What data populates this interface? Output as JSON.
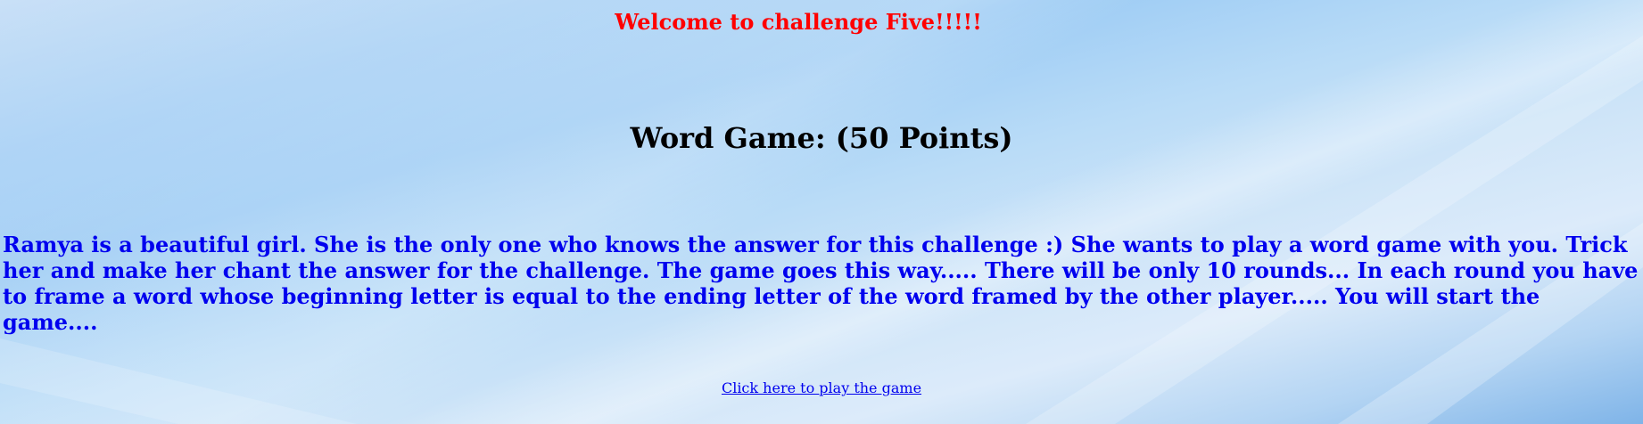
{
  "page": {
    "welcome_text": "Welcome to challenge Five!!!!!",
    "game_title": "Word Game: (50 Points)",
    "intro_text": "Ramya is a beautiful girl. She is the only one who knows the answer for this challenge :) She wants to play a word game with you. Trick her and make her chant the answer for the challenge. The game goes this way..... There will be only 10 rounds... In each round you have to frame a word whose beginning letter is equal to the ending letter of the word framed by the other player..... You will start the game....",
    "play_link_label": "Click here to play the game"
  },
  "colors": {
    "welcome": "#ff0000",
    "title": "#000000",
    "intro": "#0000ee",
    "link": "#0000ee",
    "background": "#a9d1f5"
  }
}
